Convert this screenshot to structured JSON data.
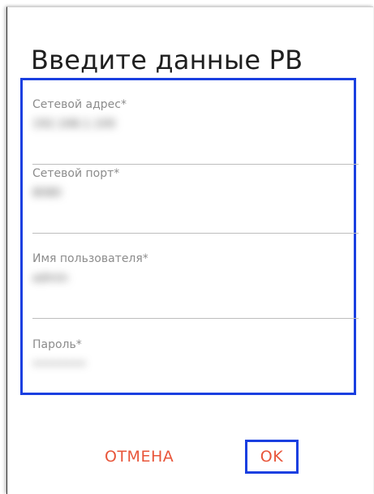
{
  "dialog": {
    "title": "Введите данные РВ",
    "fields": [
      {
        "label": "Сетевой адрес*",
        "value": "192.168.1.100"
      },
      {
        "label": "Сетевой порт*",
        "value": "8080"
      },
      {
        "label": "Имя пользователя*",
        "value": "admin"
      },
      {
        "label": "Пароль*",
        "value": "••••••••"
      }
    ],
    "cancel_label": "ОТМЕНА",
    "ok_label": "OK"
  },
  "colors": {
    "highlight": "#1a3fe0",
    "accent": "#e8553a",
    "label": "#8c8c8c",
    "divider": "#bdbdbd"
  }
}
